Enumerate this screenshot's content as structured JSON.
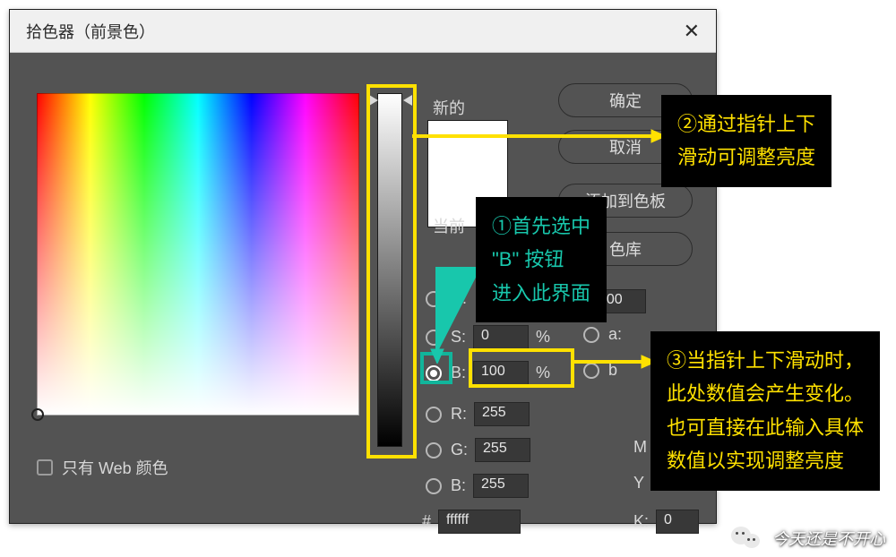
{
  "title": "拾色器（前景色）",
  "close_glyph": "✕",
  "labels": {
    "new": "新的",
    "current": "当前"
  },
  "buttons": {
    "ok": "确定",
    "cancel": "取消",
    "add_to_swatches": "添加到色板",
    "color_libraries": "色库"
  },
  "hsb": {
    "h_label": "H:",
    "h_value": "",
    "h_unit": "",
    "s_label": "S:",
    "s_value": "0",
    "s_unit": "%",
    "b_label": "B:",
    "b_value": "100",
    "b_unit": "%"
  },
  "rgb": {
    "r_label": "R:",
    "r_value": "255",
    "g_label": "G:",
    "g_value": "255",
    "b_label": "B:",
    "b_value": "255"
  },
  "lab": {
    "l_label": "",
    "l_value": "100",
    "a_label": "a:",
    "a_value": "",
    "b_label": "b"
  },
  "cmyk": {
    "m_label": "M",
    "y_label": "Y",
    "k_label": "K:",
    "k_value": "0"
  },
  "hex": {
    "prefix": "#",
    "value": "ffffff"
  },
  "web_only": "只有 Web 颜色",
  "annotations": {
    "a1_line1": "①首先选中",
    "a1_line2": "\"B\" 按钮",
    "a1_line3": "进入此界面",
    "a2_line1": "②通过指针上下",
    "a2_line2": "滑动可调整亮度",
    "a3_line1": "③当指针上下滑动时，",
    "a3_line2": "此处数值会产生变化。",
    "a3_line3": "也可直接在此输入具体",
    "a3_line4": "数值以实现调整亮度"
  },
  "watermark": "今天还是不开心"
}
